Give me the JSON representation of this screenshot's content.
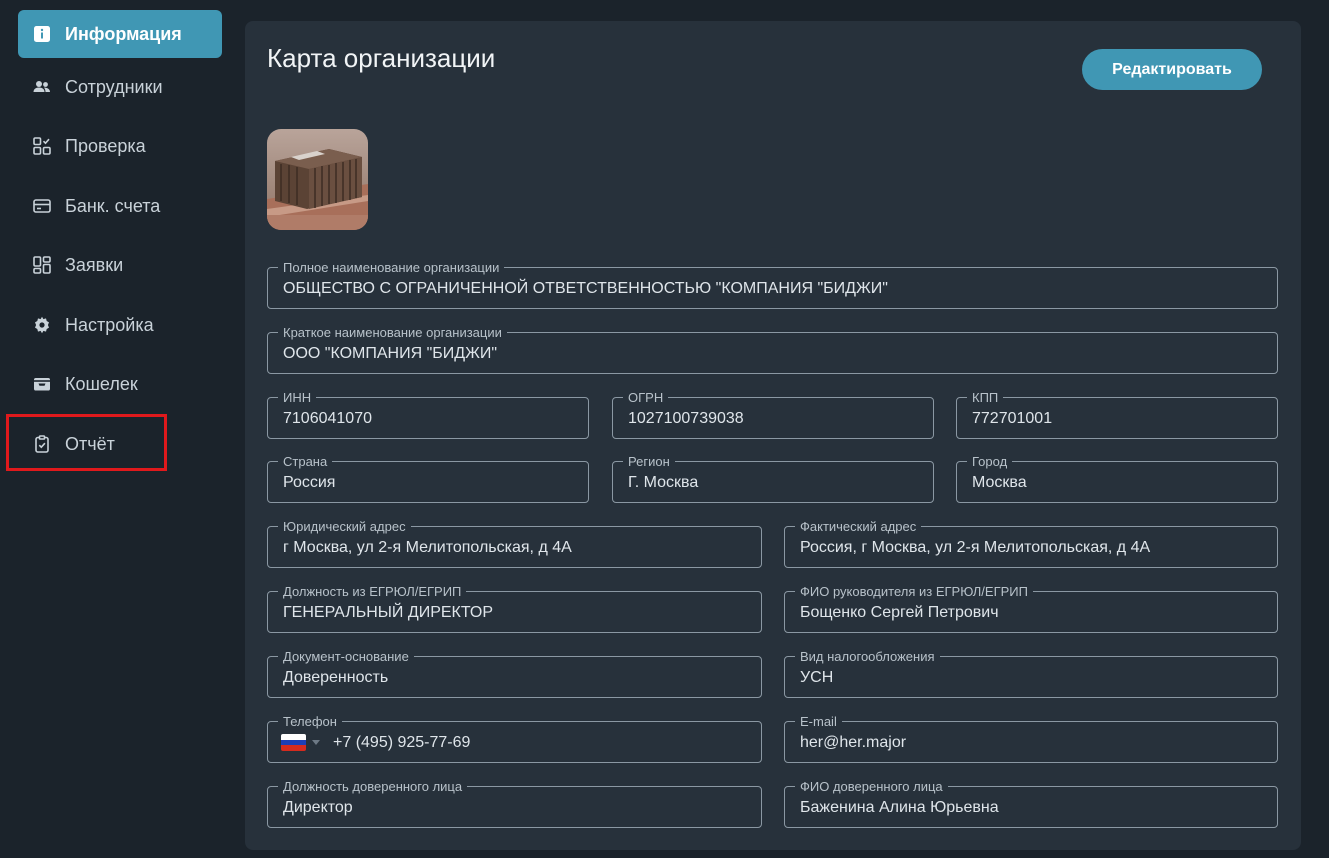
{
  "sidebar": {
    "items": [
      {
        "label": "Информация",
        "icon": "info-icon",
        "active": true
      },
      {
        "label": "Сотрудники",
        "icon": "users-icon"
      },
      {
        "label": "Проверка",
        "icon": "check-grid-icon"
      },
      {
        "label": "Банк. счета",
        "icon": "bank-card-icon"
      },
      {
        "label": "Заявки",
        "icon": "applications-grid-icon"
      },
      {
        "label": "Настройка",
        "icon": "gear-icon"
      },
      {
        "label": "Кошелек",
        "icon": "wallet-icon"
      },
      {
        "label": "Отчёт",
        "icon": "report-clipboard-icon"
      }
    ]
  },
  "card": {
    "title": "Карта организации",
    "edit_label": "Редактировать"
  },
  "fields": {
    "full_name": {
      "label": "Полное наименование организации",
      "value": "ОБЩЕСТВО С ОГРАНИЧЕННОЙ ОТВЕТСТВЕННОСТЬЮ \"КОМПАНИЯ \"БИДЖИ\""
    },
    "short_name": {
      "label": "Краткое наименование организации",
      "value": "ООО \"КОМПАНИЯ \"БИДЖИ\""
    },
    "inn": {
      "label": "ИНН",
      "value": "7106041070"
    },
    "ogrn": {
      "label": "ОГРН",
      "value": "1027100739038"
    },
    "kpp": {
      "label": "КПП",
      "value": "772701001"
    },
    "country": {
      "label": "Страна",
      "value": "Россия"
    },
    "region": {
      "label": "Регион",
      "value": "Г. Москва"
    },
    "city": {
      "label": "Город",
      "value": "Москва"
    },
    "legal_address": {
      "label": "Юридический адрес",
      "value": "г Москва, ул 2-я Мелитопольская, д 4А"
    },
    "actual_address": {
      "label": "Фактический адрес",
      "value": "Россия, г Москва, ул 2-я Мелитопольская, д 4А"
    },
    "position_egrul": {
      "label": "Должность из ЕГРЮЛ/ЕГРИП",
      "value": "ГЕНЕРАЛЬНЫЙ ДИРЕКТОР"
    },
    "director_name": {
      "label": "ФИО руководителя из ЕГРЮЛ/ЕГРИП",
      "value": "Бощенко Сергей Петрович"
    },
    "basis_document": {
      "label": "Документ-основание",
      "value": "Доверенность"
    },
    "tax_system": {
      "label": "Вид налогообложения",
      "value": "УСН"
    },
    "phone": {
      "label": "Телефон",
      "value": "+7 (495) 925-77-69",
      "flag_colors": [
        "#ffffff",
        "#1c3fb7",
        "#d52b1e"
      ]
    },
    "email": {
      "label": "E-mail",
      "value": "her@her.major"
    },
    "proxy_position": {
      "label": "Должность доверенного лица",
      "value": "Директор"
    },
    "proxy_name": {
      "label": "ФИО доверенного лица",
      "value": "Баженина Алина Юрьевна"
    }
  },
  "colors": {
    "accent": "#4097b4",
    "highlight": "#e0191c",
    "background": "#1b232b",
    "card": "#27313b"
  }
}
